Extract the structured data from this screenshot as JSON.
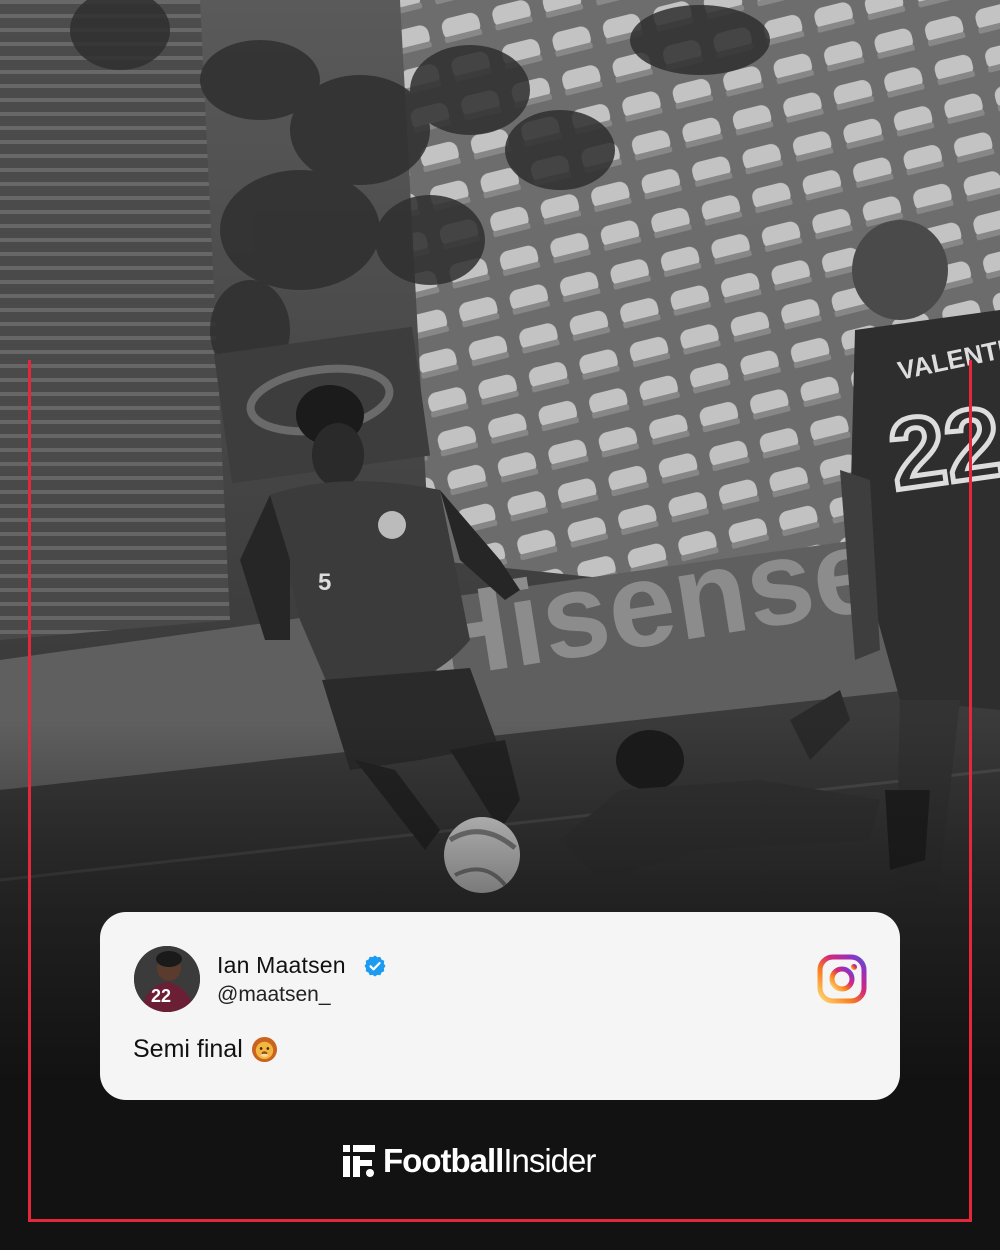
{
  "post": {
    "author_name": "Ian Maatsen",
    "author_handle": "@maatsen_",
    "caption": "Semi final",
    "caption_emoji": "lion-emoji",
    "platform_icon": "instagram-icon",
    "verified_icon": "verified-badge-icon"
  },
  "background": {
    "ad_board_text": "Hisense",
    "player_front_number": "5",
    "player_right_name": "VALENTE",
    "player_right_number": "22",
    "avatar_number": "22"
  },
  "brand": {
    "logo_icon": "football-insider-logo-icon",
    "name_bold": "Football",
    "name_light": "Insider"
  },
  "colors": {
    "frame": "#e3283c",
    "card_bg": "#f5f5f5",
    "verified": "#1d9bf0"
  }
}
